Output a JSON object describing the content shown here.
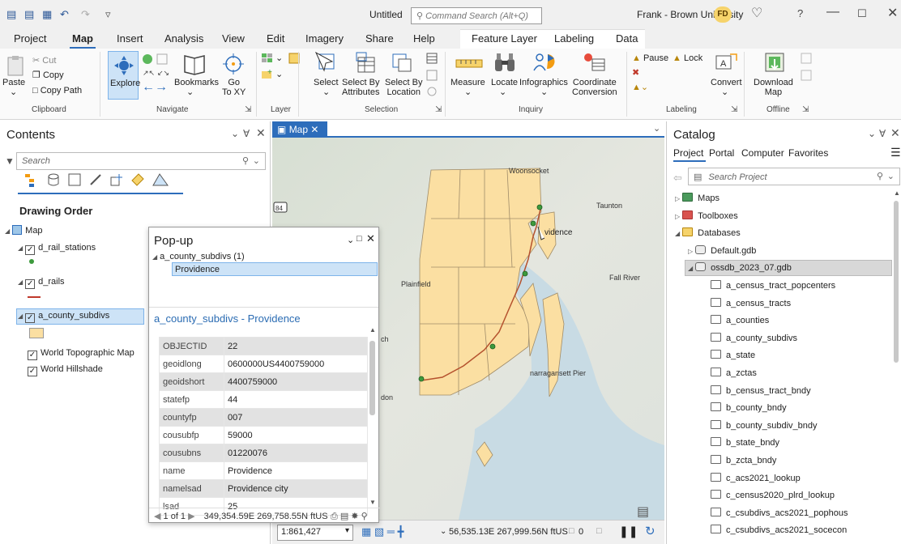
{
  "window": {
    "title": "Untitled",
    "command_search_placeholder": "Command Search (Alt+Q)",
    "user": "Frank - Brown University",
    "user_initials": "FD"
  },
  "menu": {
    "tabs": [
      "Project",
      "Map",
      "Insert",
      "Analysis",
      "View",
      "Edit",
      "Imagery",
      "Share",
      "Help",
      "Feature Layer",
      "Labeling",
      "Data"
    ],
    "active": "Map"
  },
  "ribbon": {
    "clipboard": {
      "paste": "Paste",
      "cut": "Cut",
      "copy": "Copy",
      "copy_path": "Copy Path",
      "group": "Clipboard"
    },
    "navigate": {
      "explore": "Explore",
      "bookmarks": "Bookmarks",
      "goto": "Go\nTo XY",
      "group": "Navigate"
    },
    "layer": {
      "group": "Layer"
    },
    "selection": {
      "select": "Select",
      "select_by_attr": "Select By\nAttributes",
      "select_by_loc": "Select By\nLocation",
      "group": "Selection"
    },
    "inquiry": {
      "measure": "Measure",
      "locate": "Locate",
      "infographics": "Infographics",
      "coord": "Coordinate\nConversion",
      "group": "Inquiry"
    },
    "labeling": {
      "pause": "Pause",
      "lock": "Lock",
      "convert": "Convert",
      "group": "Labeling"
    },
    "offline": {
      "download": "Download\nMap",
      "group": "Offline"
    }
  },
  "contents": {
    "title": "Contents",
    "search_placeholder": "Search",
    "drawing_order": "Drawing Order",
    "layers": [
      {
        "name": "Map"
      },
      {
        "name": "d_rail_stations"
      },
      {
        "name": "d_rails"
      },
      {
        "name": "a_county_subdivs"
      },
      {
        "name": "World Topographic Map"
      },
      {
        "name": "World Hillshade"
      }
    ]
  },
  "mapview": {
    "tab_label": "Map",
    "labels": {
      "woonsocket": "Woonsocket",
      "taunton": "Taunton",
      "providence": "vidence",
      "plainfield": "Plainfield",
      "fall_river": "Fall River",
      "narragansett": "narragansett Pier",
      "ch": "ch",
      "don": "don",
      "route": "84"
    },
    "scale": "1:861,427",
    "coords": "56,535.13E 267,999.56N ftUS",
    "selected_count": "0"
  },
  "popup": {
    "title": "Pop-up",
    "tree_layer": "a_county_subdivs (1)",
    "tree_feature": "Providence",
    "subtitle": "a_county_subdivs - Providence",
    "attributes": [
      {
        "k": "OBJECTID",
        "v": "22"
      },
      {
        "k": "geoidlong",
        "v": "0600000US4400759000"
      },
      {
        "k": "geoidshort",
        "v": "4400759000"
      },
      {
        "k": "statefp",
        "v": "44"
      },
      {
        "k": "countyfp",
        "v": "007"
      },
      {
        "k": "cousubfp",
        "v": "59000"
      },
      {
        "k": "cousubns",
        "v": "01220076"
      },
      {
        "k": "name",
        "v": "Providence"
      },
      {
        "k": "namelsad",
        "v": "Providence city"
      },
      {
        "k": "lsad",
        "v": "25"
      }
    ],
    "pager": "1 of 1",
    "coords": "349,354.59E 269,758.55N ftUS"
  },
  "catalog": {
    "title": "Catalog",
    "tabs": [
      "Project",
      "Portal",
      "Computer",
      "Favorites"
    ],
    "search_placeholder": "Search Project",
    "items": [
      {
        "label": "Maps"
      },
      {
        "label": "Toolboxes"
      },
      {
        "label": "Databases"
      },
      {
        "label": "Default.gdb"
      },
      {
        "label": "ossdb_2023_07.gdb"
      },
      {
        "label": "a_census_tract_popcenters"
      },
      {
        "label": "a_census_tracts"
      },
      {
        "label": "a_counties"
      },
      {
        "label": "a_county_subdivs"
      },
      {
        "label": "a_state"
      },
      {
        "label": "a_zctas"
      },
      {
        "label": "b_census_tract_bndy"
      },
      {
        "label": "b_county_bndy"
      },
      {
        "label": "b_county_subdiv_bndy"
      },
      {
        "label": "b_state_bndy"
      },
      {
        "label": "b_zcta_bndy"
      },
      {
        "label": "c_acs2021_lookup"
      },
      {
        "label": "c_census2020_plrd_lookup"
      },
      {
        "label": "c_csubdivs_acs2021_pophous"
      },
      {
        "label": "c_csubdivs_acs2021_socecon"
      }
    ]
  },
  "colors": {
    "accent": "#2d6dbb",
    "county_fill": "#fbdfa2",
    "rail": "#b5522e",
    "station": "#3d9a3d"
  }
}
